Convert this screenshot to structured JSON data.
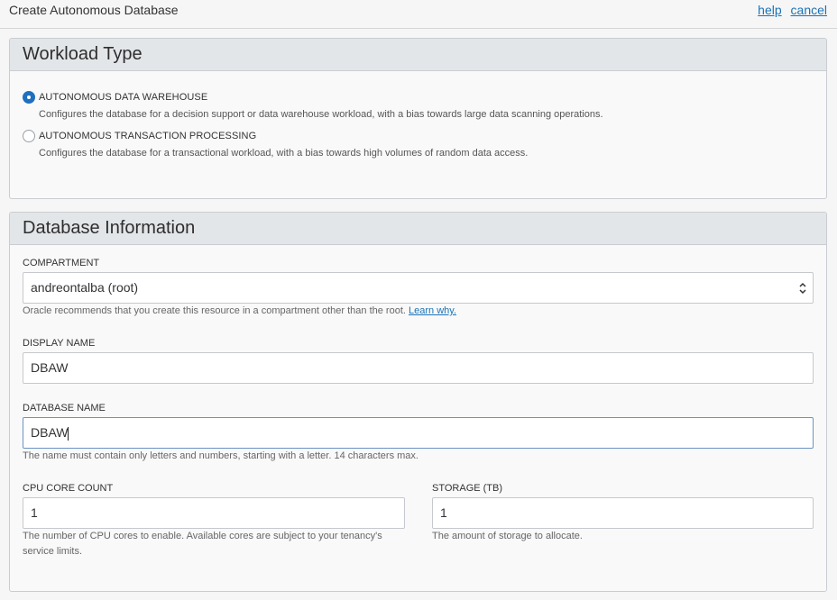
{
  "header": {
    "title": "Create Autonomous Database",
    "help_label": "help",
    "cancel_label": "cancel"
  },
  "workload": {
    "title": "Workload Type",
    "options": [
      {
        "label": "AUTONOMOUS DATA WAREHOUSE",
        "description": "Configures the database for a decision support or data warehouse workload, with a bias towards large data scanning operations.",
        "selected": true
      },
      {
        "label": "AUTONOMOUS TRANSACTION PROCESSING",
        "description": "Configures the database for a transactional workload, with a bias towards high volumes of random data access.",
        "selected": false
      }
    ]
  },
  "dbinfo": {
    "title": "Database Information",
    "compartment": {
      "label": "COMPARTMENT",
      "value": "andreontalba (root)",
      "help": "Oracle recommends that you create this resource in a compartment other than the root.",
      "help_link": "Learn why."
    },
    "display_name": {
      "label": "DISPLAY NAME",
      "value": "DBAW"
    },
    "database_name": {
      "label": "DATABASE NAME",
      "value": "DBAW",
      "help": "The name must contain only letters and numbers, starting with a letter. 14 characters max."
    },
    "cpu": {
      "label": "CPU CORE COUNT",
      "value": "1",
      "help_line1": "The number of CPU cores to enable. Available cores are subject to your tenancy's",
      "help_line2": "service limits."
    },
    "storage": {
      "label": "STORAGE (TB)",
      "value": "1",
      "help": "The amount of storage to allocate."
    }
  }
}
